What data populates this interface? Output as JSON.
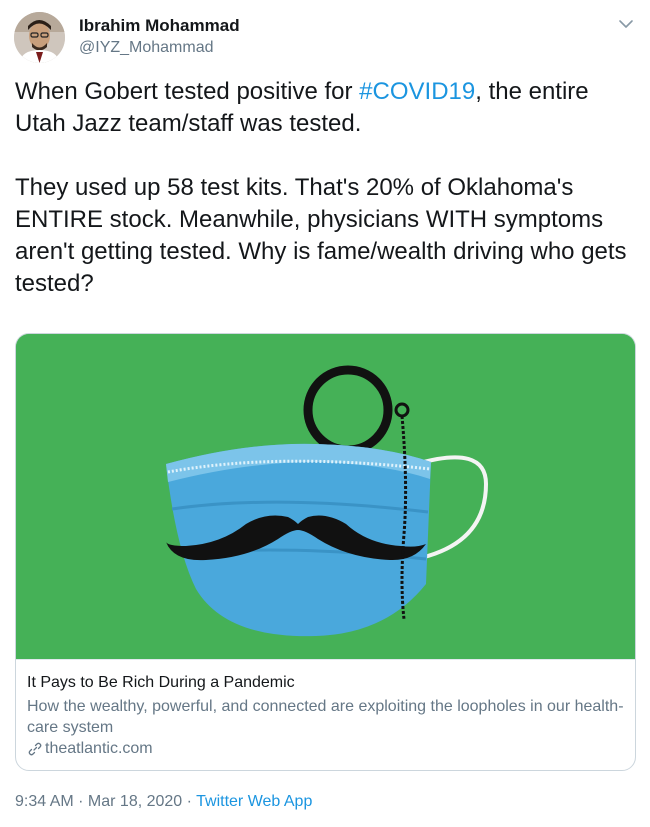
{
  "author": {
    "name": "Ibrahim Mohammad",
    "handle": "@IYZ_Mohammad"
  },
  "tweet": {
    "p1_before": "When Gobert tested positive for ",
    "hashtag": "#COVID19",
    "p1_after": ", the entire Utah Jazz team/staff was tested.",
    "p2": "They used up 58 test kits. That's 20% of Oklahoma's ENTIRE stock. Meanwhile, physicians WITH symptoms aren't getting tested. Why is fame/wealth driving who gets tested?"
  },
  "card": {
    "title": "It Pays to Be Rich During a Pandemic",
    "description": "How the wealthy, powerful, and connected are exploiting the loopholes in our health-care system",
    "domain": "theatlantic.com",
    "image_background": "#45b157"
  },
  "meta": {
    "time": "9:34 AM",
    "separator1": " · ",
    "date": "Mar 18, 2020",
    "separator2": " · ",
    "app": "Twitter Web App"
  },
  "colors": {
    "link": "#1b95e0",
    "secondary_text": "#657786",
    "mask_blue": "#4aa8dc"
  },
  "icons": {
    "caret": "chevron-down-icon",
    "link": "link-icon"
  }
}
